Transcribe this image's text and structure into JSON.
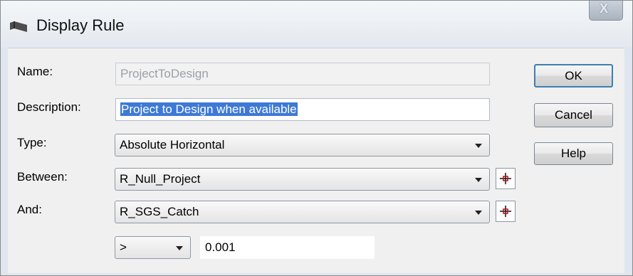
{
  "window": {
    "title": "Display Rule",
    "icons": {
      "app": "display-rule-app-icon",
      "close": "close-icon"
    },
    "close_glyph": "X"
  },
  "form": {
    "name_label": "Name:",
    "name_value": "ProjectToDesign",
    "description_label": "Description:",
    "description_value": "Project to Design when available",
    "type_label": "Type:",
    "type_value": "Absolute Horizontal",
    "between_label": "Between:",
    "between_value": "R_Null_Project",
    "and_label": "And:",
    "and_value": "R_SGS_Catch",
    "operator_value": ">",
    "threshold_value": "0.001"
  },
  "buttons": {
    "ok": "OK",
    "cancel": "Cancel",
    "help": "Help"
  },
  "colors": {
    "selection": "#3d79d6",
    "default_button_border": "#3c7fb1"
  }
}
